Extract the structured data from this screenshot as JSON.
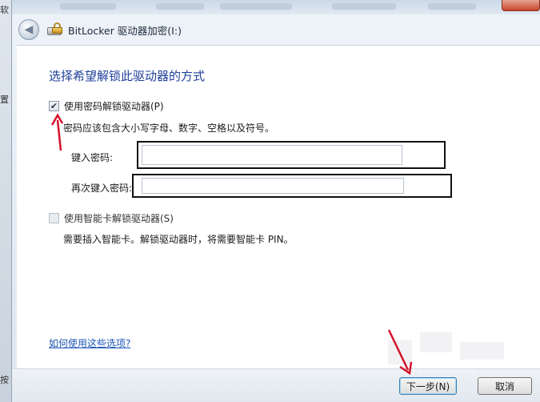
{
  "window": {
    "title": "BitLocker 驱动器加密(I:)"
  },
  "background": {
    "fragment_top": "软",
    "fragment_mid": "置",
    "fragment_bottom": "按"
  },
  "main": {
    "heading": "选择希望解锁此驱动器的方式",
    "password_option": {
      "label": "使用密码解锁驱动器(P)",
      "checked": true,
      "checkmark": "✔",
      "hint": "密码应该包含大小写字母、数字、空格以及符号。",
      "enter_label": "键入密码:",
      "enter_value": "",
      "reenter_label": "再次键入密码:",
      "reenter_value": ""
    },
    "smartcard_option": {
      "label": "使用智能卡解锁驱动器(S)",
      "checked": false,
      "hint": "需要插入智能卡。解锁驱动器时，将需要智能卡 PIN。"
    },
    "help_link": "如何使用这些选项?"
  },
  "footer": {
    "next_label": "下一步(N)",
    "cancel_label": "取消"
  },
  "watermark": {
    "text": "jingyan.baidu"
  },
  "colors": {
    "heading": "#1f3f9a",
    "link": "#1d55b5",
    "annotation_arrow": "#d4122a",
    "annotation_box": "#111111"
  }
}
